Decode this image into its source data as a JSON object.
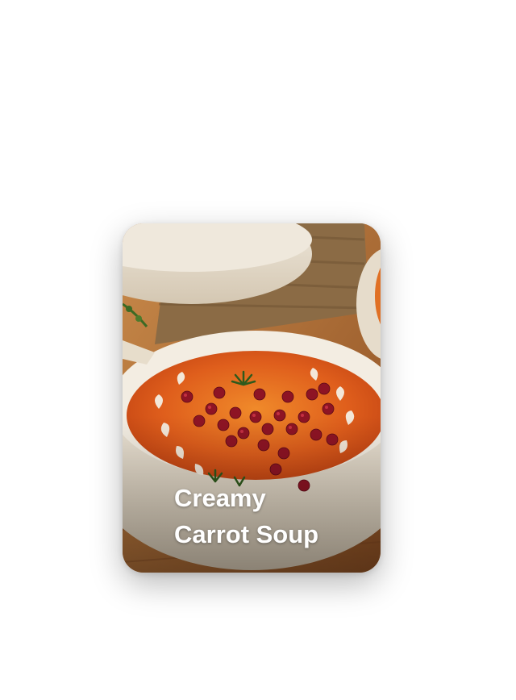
{
  "card": {
    "title_lines": [
      "Creamy",
      "Carrot Soup"
    ]
  },
  "colors": {
    "soup": "#d9531a",
    "bowl": "#ece4d6",
    "pomegranate": "#8e1424",
    "herb": "#3c6a24",
    "wood": "#b5733a",
    "burlap": "#8a6a45"
  }
}
